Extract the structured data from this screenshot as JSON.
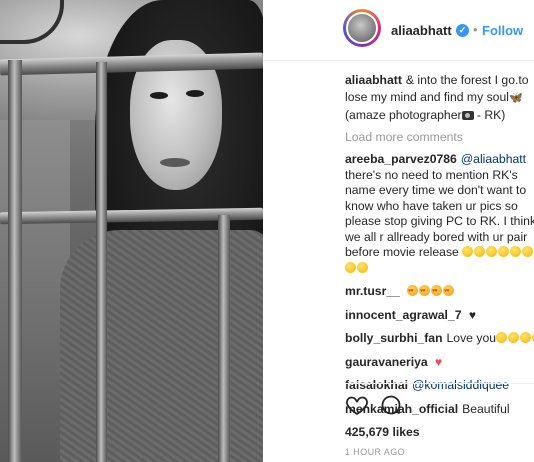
{
  "post": {
    "username": "aliaabhatt",
    "follow_label": "Follow",
    "separator": "•",
    "verified_mark": "✓",
    "caption": {
      "text_1": "& into the forest I go.to lose my mind and find my soul",
      "text_2": "(amaze photographer",
      "text_3": "- RK)"
    },
    "load_more_label": "Load more comments",
    "comments": [
      {
        "user": "areeba_parvez0786",
        "mention": "@aliaabhatt",
        "text": "there's no need to mention RK's name every time we don't want to know who have taken ur pics so please stop giving PC to RK. I think we all r allready bored with ur pair before movie release"
      },
      {
        "user": "mr.tusr__"
      },
      {
        "user": "innocent_agrawal_7"
      },
      {
        "user": "bolly_surbhi_fan",
        "text": "Love you"
      },
      {
        "user": "gauravaneriya"
      },
      {
        "user": "faisalokhai",
        "mention": "@komalsiddiquee"
      },
      {
        "user": "menkamiah_official",
        "text": "Beautiful"
      }
    ],
    "likes": "425,679 likes",
    "time": "1 HOUR AGO"
  },
  "icons": {
    "verified": "verified-badge-icon",
    "like": "heart-outline-icon",
    "comment": "speech-bubble-icon",
    "butterfly": "butterfly-emoji-icon",
    "camera": "camera-emoji-icon"
  },
  "colors": {
    "accent": "#3897f0",
    "text": "#262626",
    "muted": "#999999",
    "mention": "#003569",
    "heart": "#ed4956"
  }
}
